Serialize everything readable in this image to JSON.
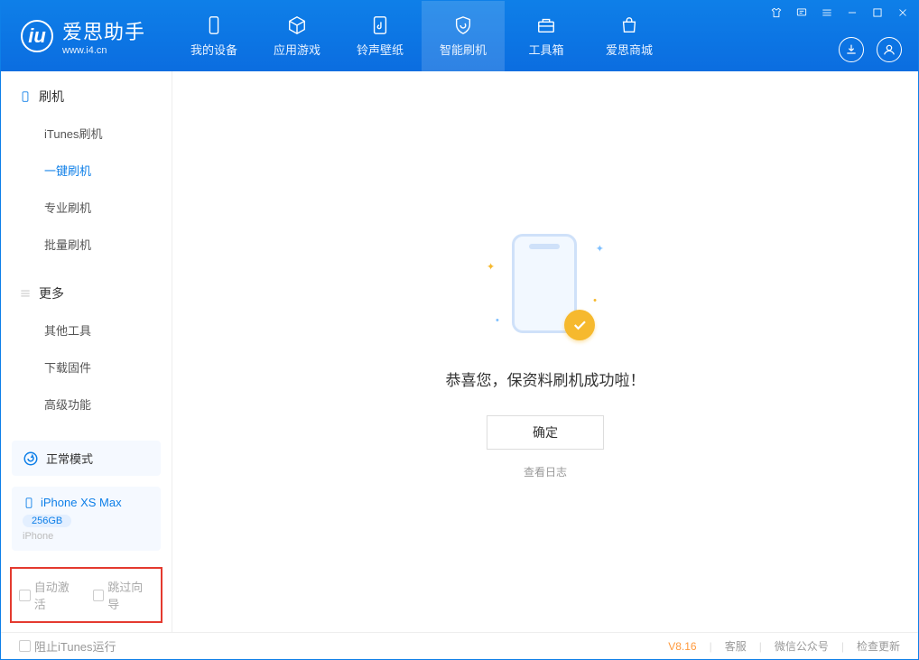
{
  "app": {
    "name": "爱思助手",
    "url": "www.i4.cn"
  },
  "nav": {
    "device": "我的设备",
    "apps": "应用游戏",
    "ring": "铃声壁纸",
    "flash": "智能刷机",
    "tools": "工具箱",
    "store": "爱思商城"
  },
  "sidebar": {
    "flash_h": "刷机",
    "items": {
      "itunes": "iTunes刷机",
      "oneclick": "一键刷机",
      "pro": "专业刷机",
      "batch": "批量刷机"
    },
    "more_h": "更多",
    "more": {
      "other": "其他工具",
      "firmware": "下载固件",
      "adv": "高级功能"
    },
    "mode": "正常模式",
    "device": {
      "name": "iPhone XS Max",
      "capacity": "256GB",
      "type": "iPhone"
    },
    "redbox": {
      "auto": "自动激活",
      "skip": "跳过向导"
    }
  },
  "main": {
    "msg": "恭喜您，保资料刷机成功啦！",
    "ok": "确定",
    "log": "查看日志"
  },
  "footer": {
    "block": "阻止iTunes运行",
    "ver": "V8.16",
    "cs": "客服",
    "wx": "微信公众号",
    "upd": "检查更新"
  }
}
